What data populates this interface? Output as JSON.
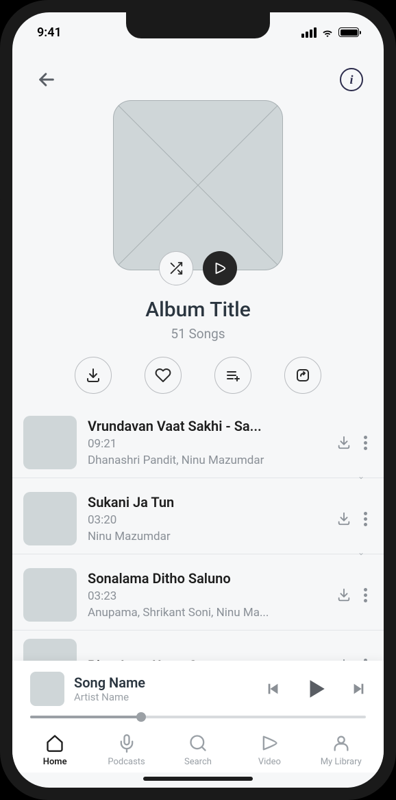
{
  "status": {
    "time": "9:41"
  },
  "album": {
    "title": "Album Title",
    "subtitle": "51 Songs"
  },
  "songs": [
    {
      "title": "Vrundavan Vaat Sakhi - Sa...",
      "duration": "09:21",
      "artist": "Dhanashri Pandit, Ninu Mazumdar",
      "chevron": true
    },
    {
      "title": "Sukani Ja Tun",
      "duration": "03:20",
      "artist": "Ninu Mazumdar",
      "chevron": true
    },
    {
      "title": "Sonalama Ditho Saluno",
      "duration": "03:23",
      "artist": "Anupama, Shrikant Soni, Ninu Ma...",
      "chevron": false
    },
    {
      "title": "Piyu Aavo Urma Samavo",
      "duration": "",
      "artist": "",
      "chevron": false
    }
  ],
  "mini_player": {
    "title": "Song Name",
    "artist": "Artist Name"
  },
  "nav": {
    "home": "Home",
    "podcasts": "Podcasts",
    "search": "Search",
    "video": "Video",
    "library": "My Library"
  }
}
